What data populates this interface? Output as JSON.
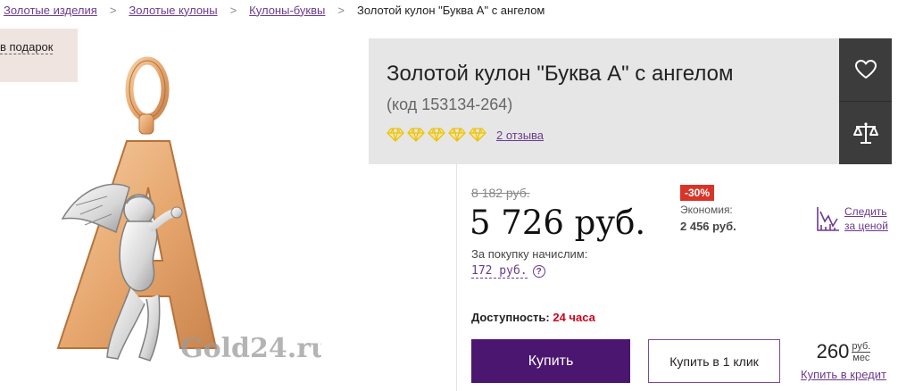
{
  "breadcrumb": {
    "items": [
      "Золотые изделия",
      "Золотые кулоны",
      "Кулоны-буквы"
    ],
    "separator": ">",
    "current": "Золотой кулон \"Буква А\" с ангелом"
  },
  "promo": {
    "label": "в подарок"
  },
  "product": {
    "title": "Золотой кулон \"Буква А\" с ангелом",
    "code": "(код 153134-264)",
    "rating": {
      "stars": 5,
      "icon": "diamond-icon",
      "color": "#e8c21c"
    },
    "reviews_label": "2 отзыва",
    "image_watermark": "Gold24.ru"
  },
  "actions": {
    "favorite_icon": "heart-icon",
    "compare_icon": "scales-icon"
  },
  "pricing": {
    "old_price": "8 182 руб.",
    "price": "5 726 руб.",
    "discount_badge": "-30%",
    "savings_label": "Экономия:",
    "savings_value": "2 456 руб.",
    "bonus_label": "За покупку начислим:",
    "bonus_value": "172 руб.",
    "bonus_help": "?",
    "track_label_1": "Следить",
    "track_label_2": "за ценой"
  },
  "availability": {
    "label": "Доступность:",
    "value": "24 часа"
  },
  "buttons": {
    "buy": "Купить",
    "one_click": "Купить в 1 клик"
  },
  "credit": {
    "amount": "260",
    "currency": "руб.",
    "period": "мес",
    "link": "Купить в кредит"
  },
  "colors": {
    "accent": "#4b1670",
    "link": "#6c3a8f",
    "sale": "#d8352a",
    "availability": "#d0021b"
  }
}
